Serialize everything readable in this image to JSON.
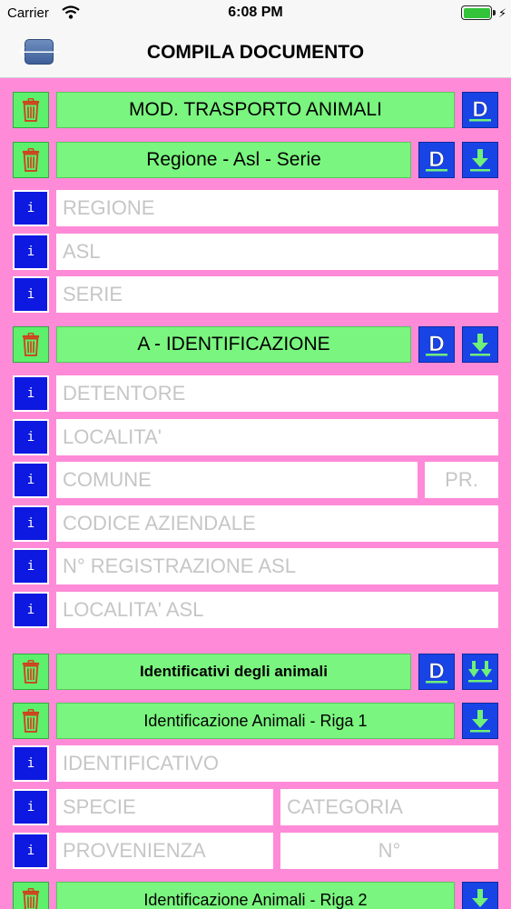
{
  "status": {
    "carrier": "Carrier",
    "time": "6:08 PM"
  },
  "nav": {
    "title": "COMPILA DOCUMENTO"
  },
  "sections": {
    "mod": {
      "title": "MOD. TRASPORTO ANIMALI"
    },
    "regione": {
      "title": "Regione - Asl -  Serie",
      "fields": {
        "regione": "REGIONE",
        "asl": "ASL",
        "serie": "SERIE"
      }
    },
    "identificazione": {
      "title": "A - IDENTIFICAZIONE",
      "fields": {
        "detentore": "DETENTORE",
        "localita": "LOCALITA'",
        "comune": "COMUNE",
        "pr": "PR.",
        "codice": "CODICE AZIENDALE",
        "registrazione": "N° REGISTRAZIONE ASL",
        "localita_asl": "LOCALITA' ASL"
      }
    },
    "identificativi": {
      "title": "Identificativi degli animali"
    },
    "riga1": {
      "title": "Identificazione Animali - Riga 1",
      "fields": {
        "identificativo": "IDENTIFICATIVO",
        "specie": "SPECIE",
        "categoria": "CATEGORIA",
        "provenienza": "PROVENIENZA",
        "numero": "N°"
      }
    },
    "riga2": {
      "title": "Identificazione Animali - Riga 2"
    }
  },
  "labels": {
    "info": "i"
  },
  "colors": {
    "background": "#ff8ad8",
    "header_green": "#7af57f",
    "button_blue": "#1844e6",
    "info_blue": "#0d19e0"
  }
}
